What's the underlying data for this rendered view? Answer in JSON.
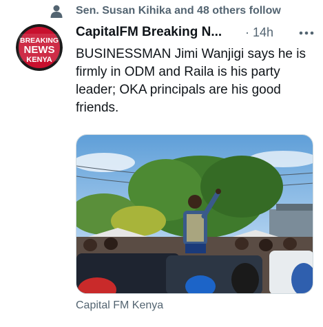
{
  "social_context": {
    "icon": "person-icon",
    "text": "Sen. Susan Kihika and 48 others follow"
  },
  "author": {
    "display_name": "CapitalFM Breaking N...",
    "avatar_text": [
      "BREAKING",
      "NEWS",
      "KENYA"
    ],
    "avatar_colors": {
      "ring": "#1a1a1a",
      "bg": "#c8102e",
      "text": "#ffffff"
    }
  },
  "tweet": {
    "time": "· 14h",
    "text": "BUSINESSMAN Jimi Wanjigi says he is firmly in ODM and Raila is his party leader; OKA principals are his good friends.",
    "more_icon": "more-horizontal-icon"
  },
  "card": {
    "source": "Capital FM Kenya"
  },
  "colors": {
    "primary_text": "#0f1419",
    "secondary_text": "#536471"
  }
}
